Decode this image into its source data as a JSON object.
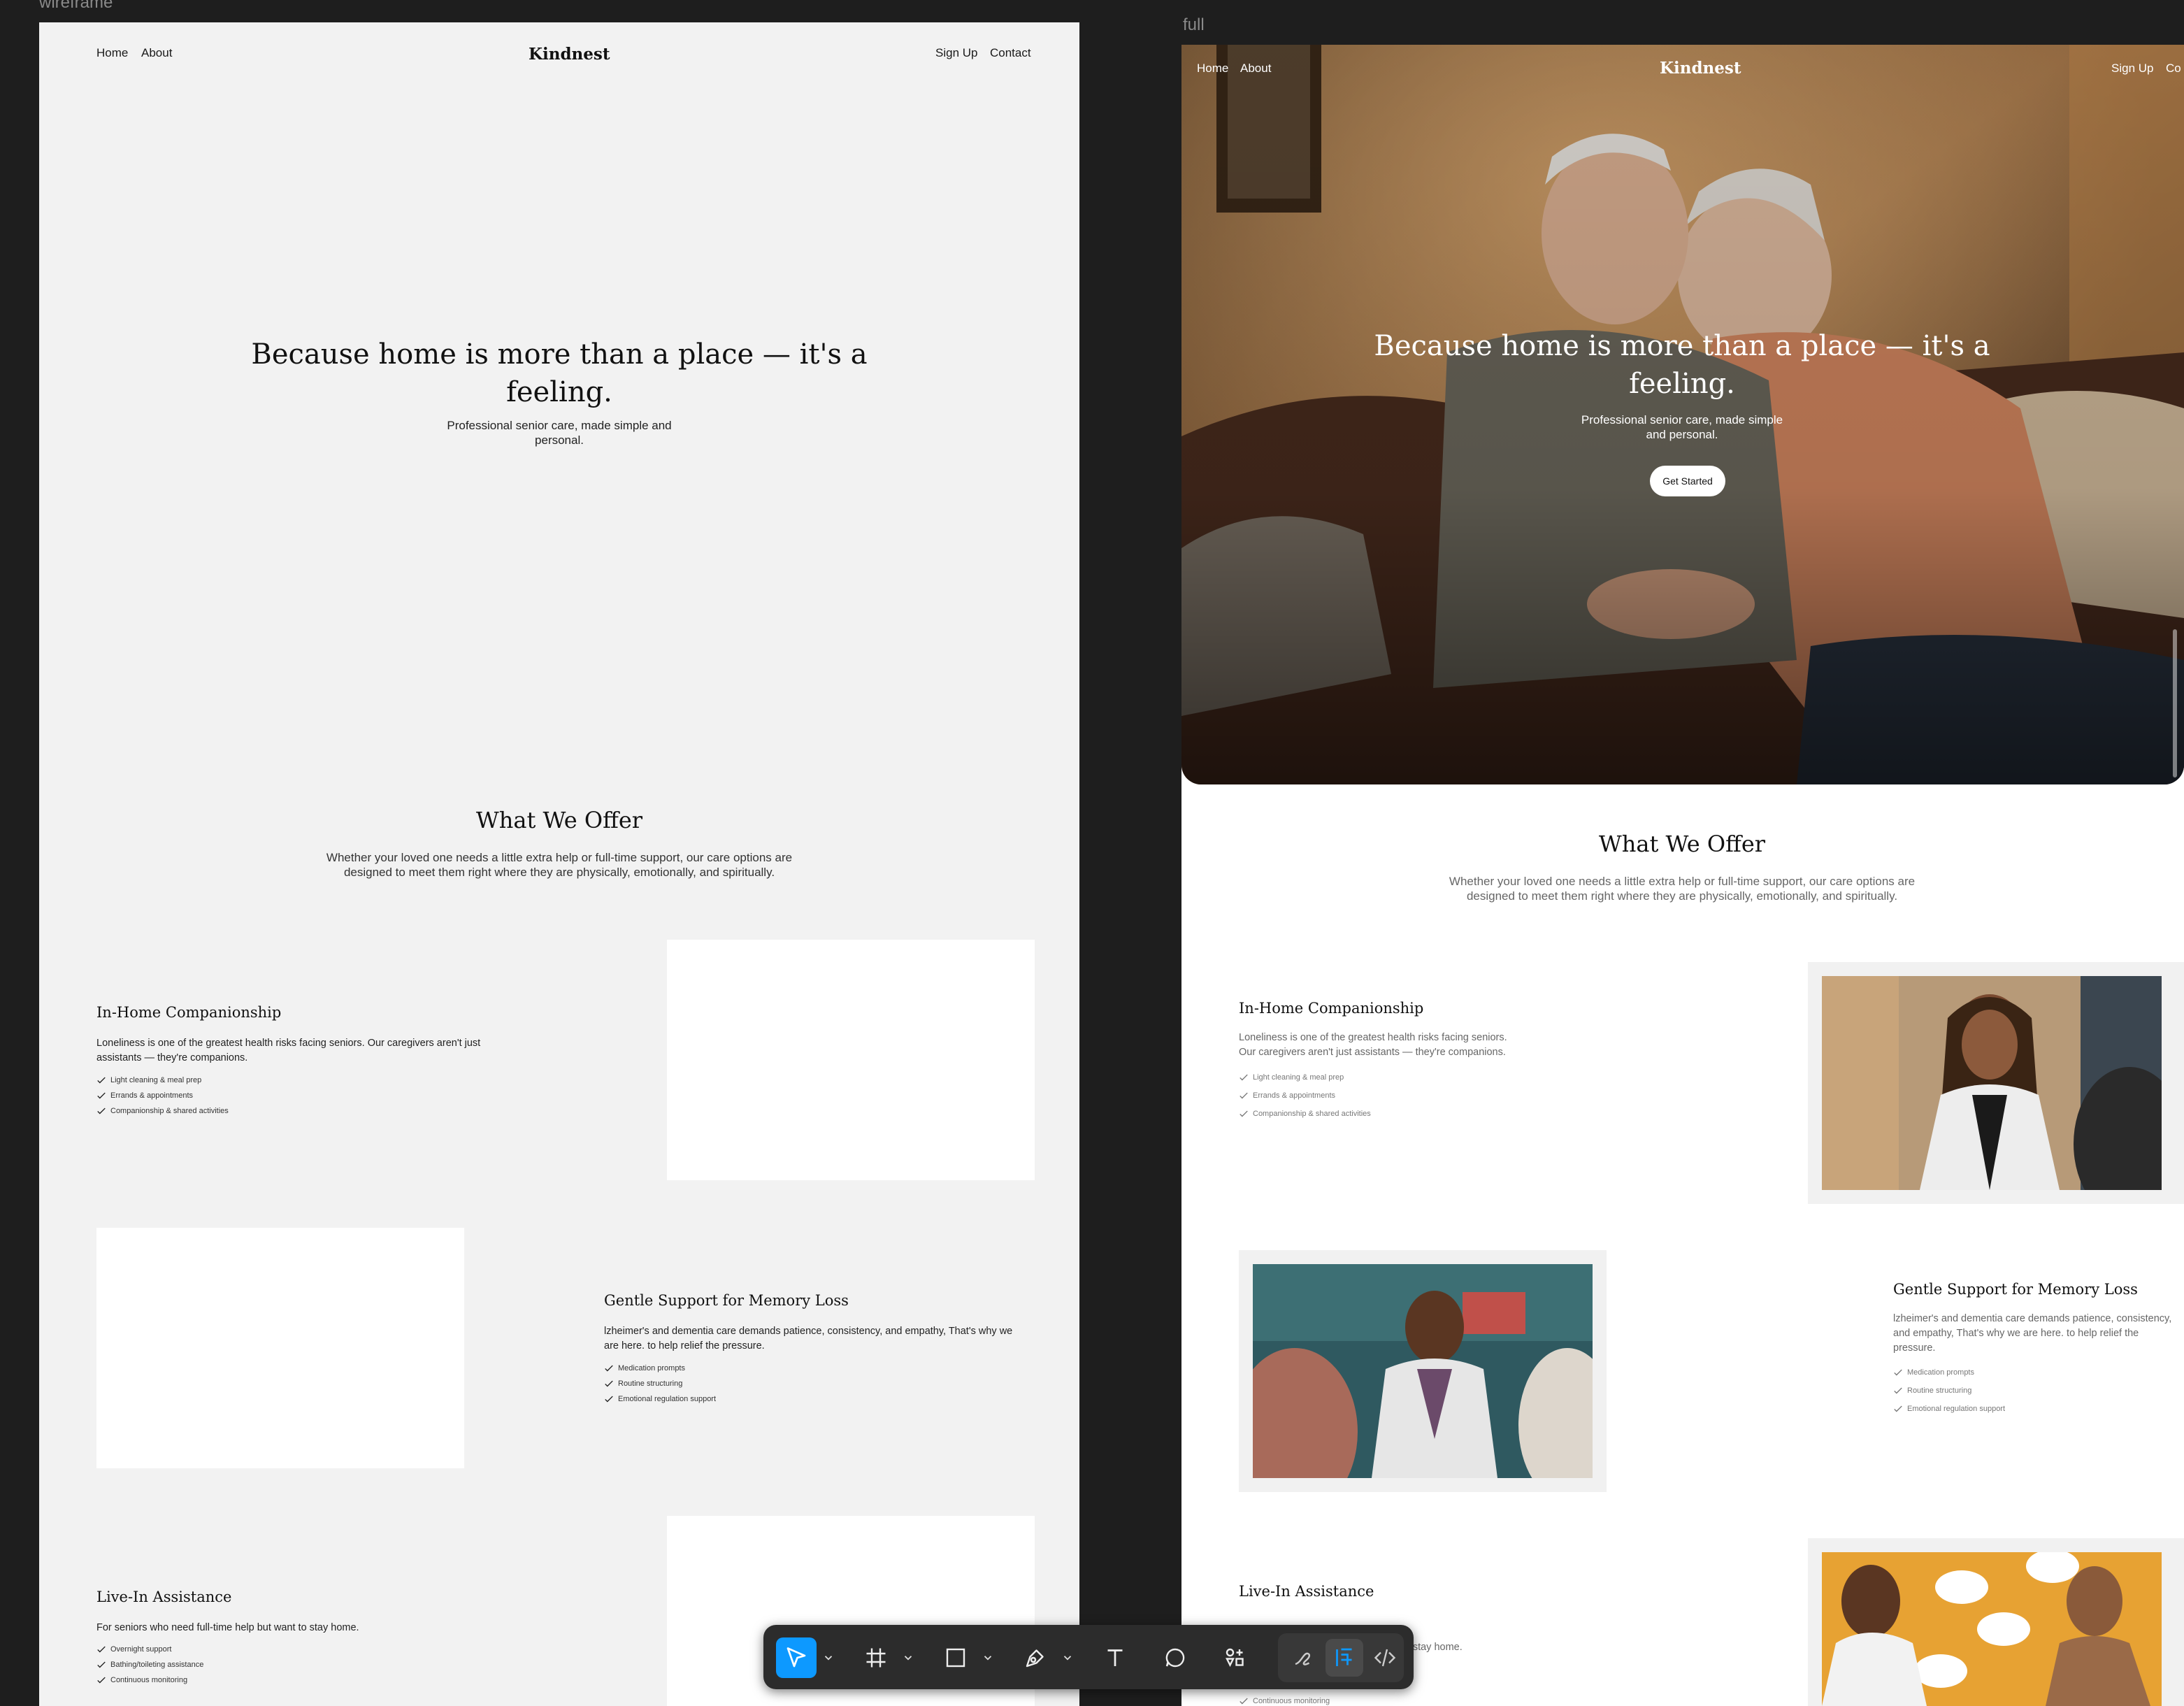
{
  "canvas": {
    "wireframe_label": "wireframe",
    "full_label": "full"
  },
  "wireframe": {
    "nav": {
      "left": [
        "Home",
        "About"
      ],
      "brand": "Kindnest",
      "right": [
        "Sign Up",
        "Contact"
      ]
    },
    "hero": {
      "title_line1": "Because home is more than a place — it's a",
      "title_line2": "feeling.",
      "subtitle_line1": "Professional senior care, made simple and",
      "subtitle_line2": "personal."
    },
    "offer": {
      "title": "What We Offer",
      "sub_line1": "Whether your loved one needs a little extra help or full-time support, our care options are",
      "sub_line2": "designed to meet them right where they are physically, emotionally, and spiritually."
    },
    "services": [
      {
        "title": "In-Home Companionship",
        "desc_line1": "Loneliness is one of the greatest health risks facing seniors. Our caregivers aren't just",
        "desc_line2": "assistants — they're companions.",
        "items": [
          "Light cleaning & meal prep",
          "Errands & appointments",
          "Companionship & shared activities"
        ]
      },
      {
        "title": "Gentle Support for Memory Loss",
        "desc_line1": "lzheimer's and dementia care demands patience, consistency, and empathy, That's why we",
        "desc_line2": "are here. to help relief the pressure.",
        "items": [
          "Medication prompts",
          "Routine structuring",
          "Emotional regulation support"
        ]
      },
      {
        "title": "Live-In Assistance",
        "desc_line1": "For seniors who need full-time help but want to stay home.",
        "items": [
          "Overnight support",
          "Bathing/toileting assistance",
          "Continuous monitoring"
        ]
      }
    ]
  },
  "full": {
    "nav": {
      "left": [
        "Home",
        "About"
      ],
      "brand": "Kindnest",
      "right": [
        "Sign Up",
        "Co"
      ]
    },
    "hero": {
      "title_line1": "Because home is more than a place — it's a",
      "title_line2": "feeling.",
      "subtitle_line1": "Professional senior care, made simple",
      "subtitle_line2": "and personal.",
      "cta": "Get Started"
    },
    "offer": {
      "title": "What We Offer",
      "sub_line1": "Whether your loved one needs a little extra help or full-time support, our care options are",
      "sub_line2": "designed to meet them right where they are physically, emotionally, and spiritually."
    },
    "services": [
      {
        "title": "In-Home Companionship",
        "desc_line1": "Loneliness is one of the greatest health risks facing seniors.",
        "desc_line2": "Our caregivers aren't just assistants — they're companions.",
        "items": [
          "Light cleaning & meal prep",
          "Errands & appointments",
          "Companionship & shared activities"
        ]
      },
      {
        "title": "Gentle Support for Memory Loss",
        "desc_line1": "lzheimer's and dementia care demands patience, consistency,",
        "desc_line2": "and empathy, That's why we are here. to help relief the",
        "desc_line3": "pressure.",
        "items": [
          "Medication prompts",
          "Routine structuring",
          "Emotional regulation support"
        ]
      },
      {
        "title": "Live-In Assistance",
        "desc_partial": "t want to stay home.",
        "items_partial": [
          "Continuous monitoring"
        ]
      }
    ]
  },
  "toolbar": {
    "tools": [
      "move-tool",
      "frame-tool",
      "rectangle-tool",
      "pen-tool",
      "text-tool",
      "comment-tool",
      "actions-tool",
      "draw-mode",
      "design-mode",
      "dev-mode"
    ],
    "active": "move-tool",
    "accent": "#0d99ff"
  }
}
